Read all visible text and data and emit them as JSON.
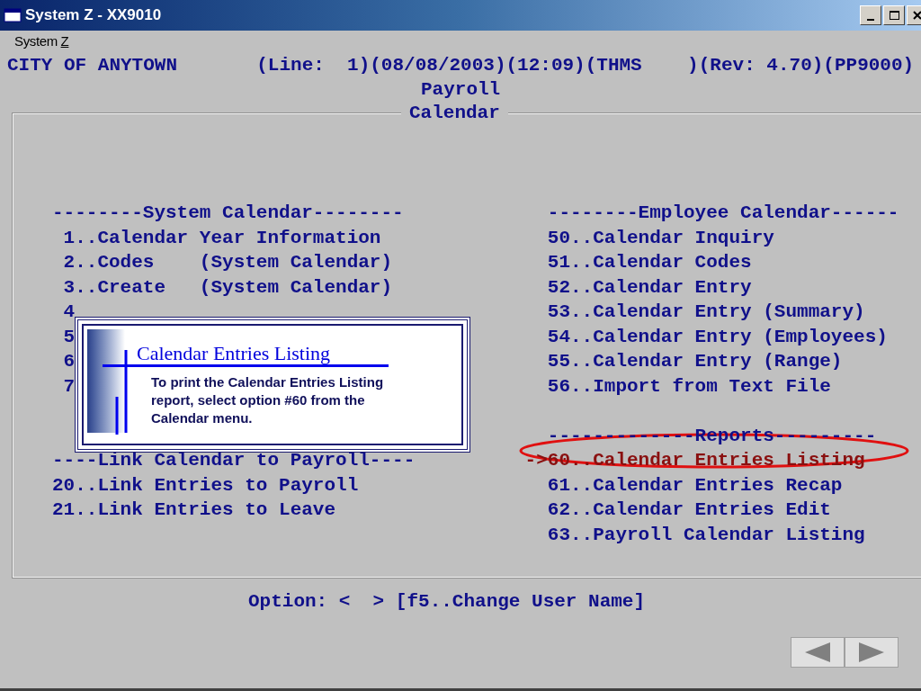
{
  "window": {
    "title": "System Z - XX9010"
  },
  "menu": [
    "System Z"
  ],
  "header": "CITY OF ANYTOWN       (Line:  1)(08/08/2003)(12:09)(THMS    )(Rev: 4.70)(PP9000)",
  "subtitle": "Payroll",
  "frame_title": "Calendar",
  "left_sections": [
    {
      "lines": [
        {
          "text": "--------System Calendar--------"
        },
        {
          "text": " 1..Calendar Year Information"
        },
        {
          "text": " 2..Codes    (System Calendar)"
        },
        {
          "text": " 3..Create   (System Calendar)"
        },
        {
          "text": " 4"
        },
        {
          "text": " 5"
        },
        {
          "text": " 6"
        },
        {
          "text": " 7"
        }
      ]
    },
    {
      "lines": [
        {
          "text": "----Link Calendar to Payroll----"
        },
        {
          "text": "20..Link Entries to Payroll"
        },
        {
          "text": "21..Link Entries to Leave"
        }
      ]
    }
  ],
  "right_sections": [
    {
      "lines": [
        {
          "text": "  --------Employee Calendar------",
          "selected": false
        },
        {
          "text": "  50..Calendar Inquiry",
          "selected": false
        },
        {
          "text": "  51..Calendar Codes",
          "selected": false
        },
        {
          "text": "  52..Calendar Entry",
          "selected": false
        },
        {
          "text": "  53..Calendar Entry (Summary)",
          "selected": false
        },
        {
          "text": "  54..Calendar Entry (Employees)",
          "selected": false
        },
        {
          "text": "  55..Calendar Entry (Range)",
          "selected": false
        },
        {
          "text": "  56..Import from Text File",
          "selected": false
        }
      ]
    },
    {
      "lines": [
        {
          "text": "  -------------Reports---------",
          "selected": false
        },
        {
          "text": "->60..Calendar Entries Listing",
          "selected": true
        },
        {
          "text": "  61..Calendar Entries Recap",
          "selected": false
        },
        {
          "text": "  62..Calendar Entries Edit",
          "selected": false
        },
        {
          "text": "  63..Payroll Calendar Listing",
          "selected": false
        }
      ]
    }
  ],
  "callout": {
    "title": "Calendar Entries Listing",
    "text": "To print the Calendar Entries Listing report, select option #60 from the Calendar menu."
  },
  "prompt": "Option: <  > [f5..Change User Name]"
}
